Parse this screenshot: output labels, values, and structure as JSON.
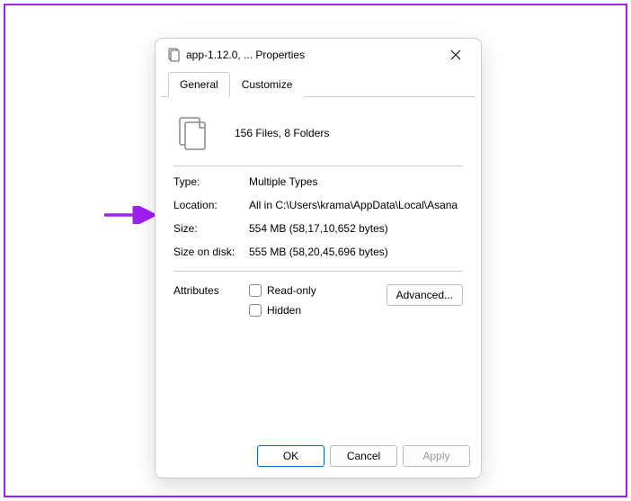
{
  "titlebar": {
    "title": "app-1.12.0, ... Properties"
  },
  "tabs": {
    "general": "General",
    "customize": "Customize"
  },
  "summary": "156 Files, 8 Folders",
  "props": {
    "type_label": "Type:",
    "type_value": "Multiple Types",
    "location_label": "Location:",
    "location_value": "All in C:\\Users\\krama\\AppData\\Local\\Asana",
    "size_label": "Size:",
    "size_value": "554 MB (58,17,10,652 bytes)",
    "disk_label": "Size on disk:",
    "disk_value": "555 MB (58,20,45,696 bytes)"
  },
  "attributes": {
    "label": "Attributes",
    "readonly": "Read-only",
    "hidden": "Hidden",
    "advanced": "Advanced..."
  },
  "footer": {
    "ok": "OK",
    "cancel": "Cancel",
    "apply": "Apply"
  },
  "annotation_color": "#a020f0"
}
